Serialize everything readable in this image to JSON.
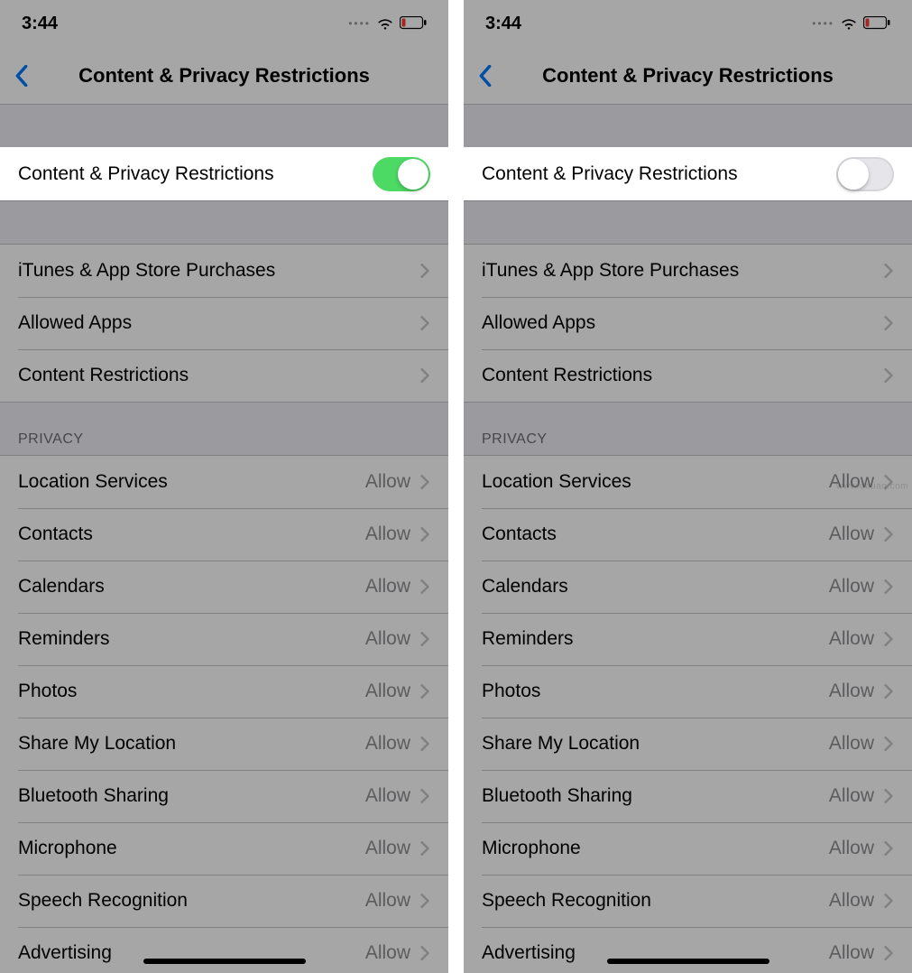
{
  "status": {
    "time": "3:44"
  },
  "nav": {
    "title": "Content & Privacy Restrictions"
  },
  "toggleRow": {
    "label": "Content & Privacy Restrictions"
  },
  "group1": {
    "items": [
      {
        "label": "iTunes & App Store Purchases"
      },
      {
        "label": "Allowed Apps"
      },
      {
        "label": "Content Restrictions"
      }
    ]
  },
  "privacy": {
    "header": "PRIVACY",
    "items": [
      {
        "label": "Location Services",
        "value": "Allow"
      },
      {
        "label": "Contacts",
        "value": "Allow"
      },
      {
        "label": "Calendars",
        "value": "Allow"
      },
      {
        "label": "Reminders",
        "value": "Allow"
      },
      {
        "label": "Photos",
        "value": "Allow"
      },
      {
        "label": "Share My Location",
        "value": "Allow"
      },
      {
        "label": "Bluetooth Sharing",
        "value": "Allow"
      },
      {
        "label": "Microphone",
        "value": "Allow"
      },
      {
        "label": "Speech Recognition",
        "value": "Allow"
      },
      {
        "label": "Advertising",
        "value": "Allow"
      }
    ]
  },
  "screens": {
    "left": {
      "toggle": "on"
    },
    "right": {
      "toggle": "off"
    }
  },
  "watermark": "www.deuaq.com"
}
